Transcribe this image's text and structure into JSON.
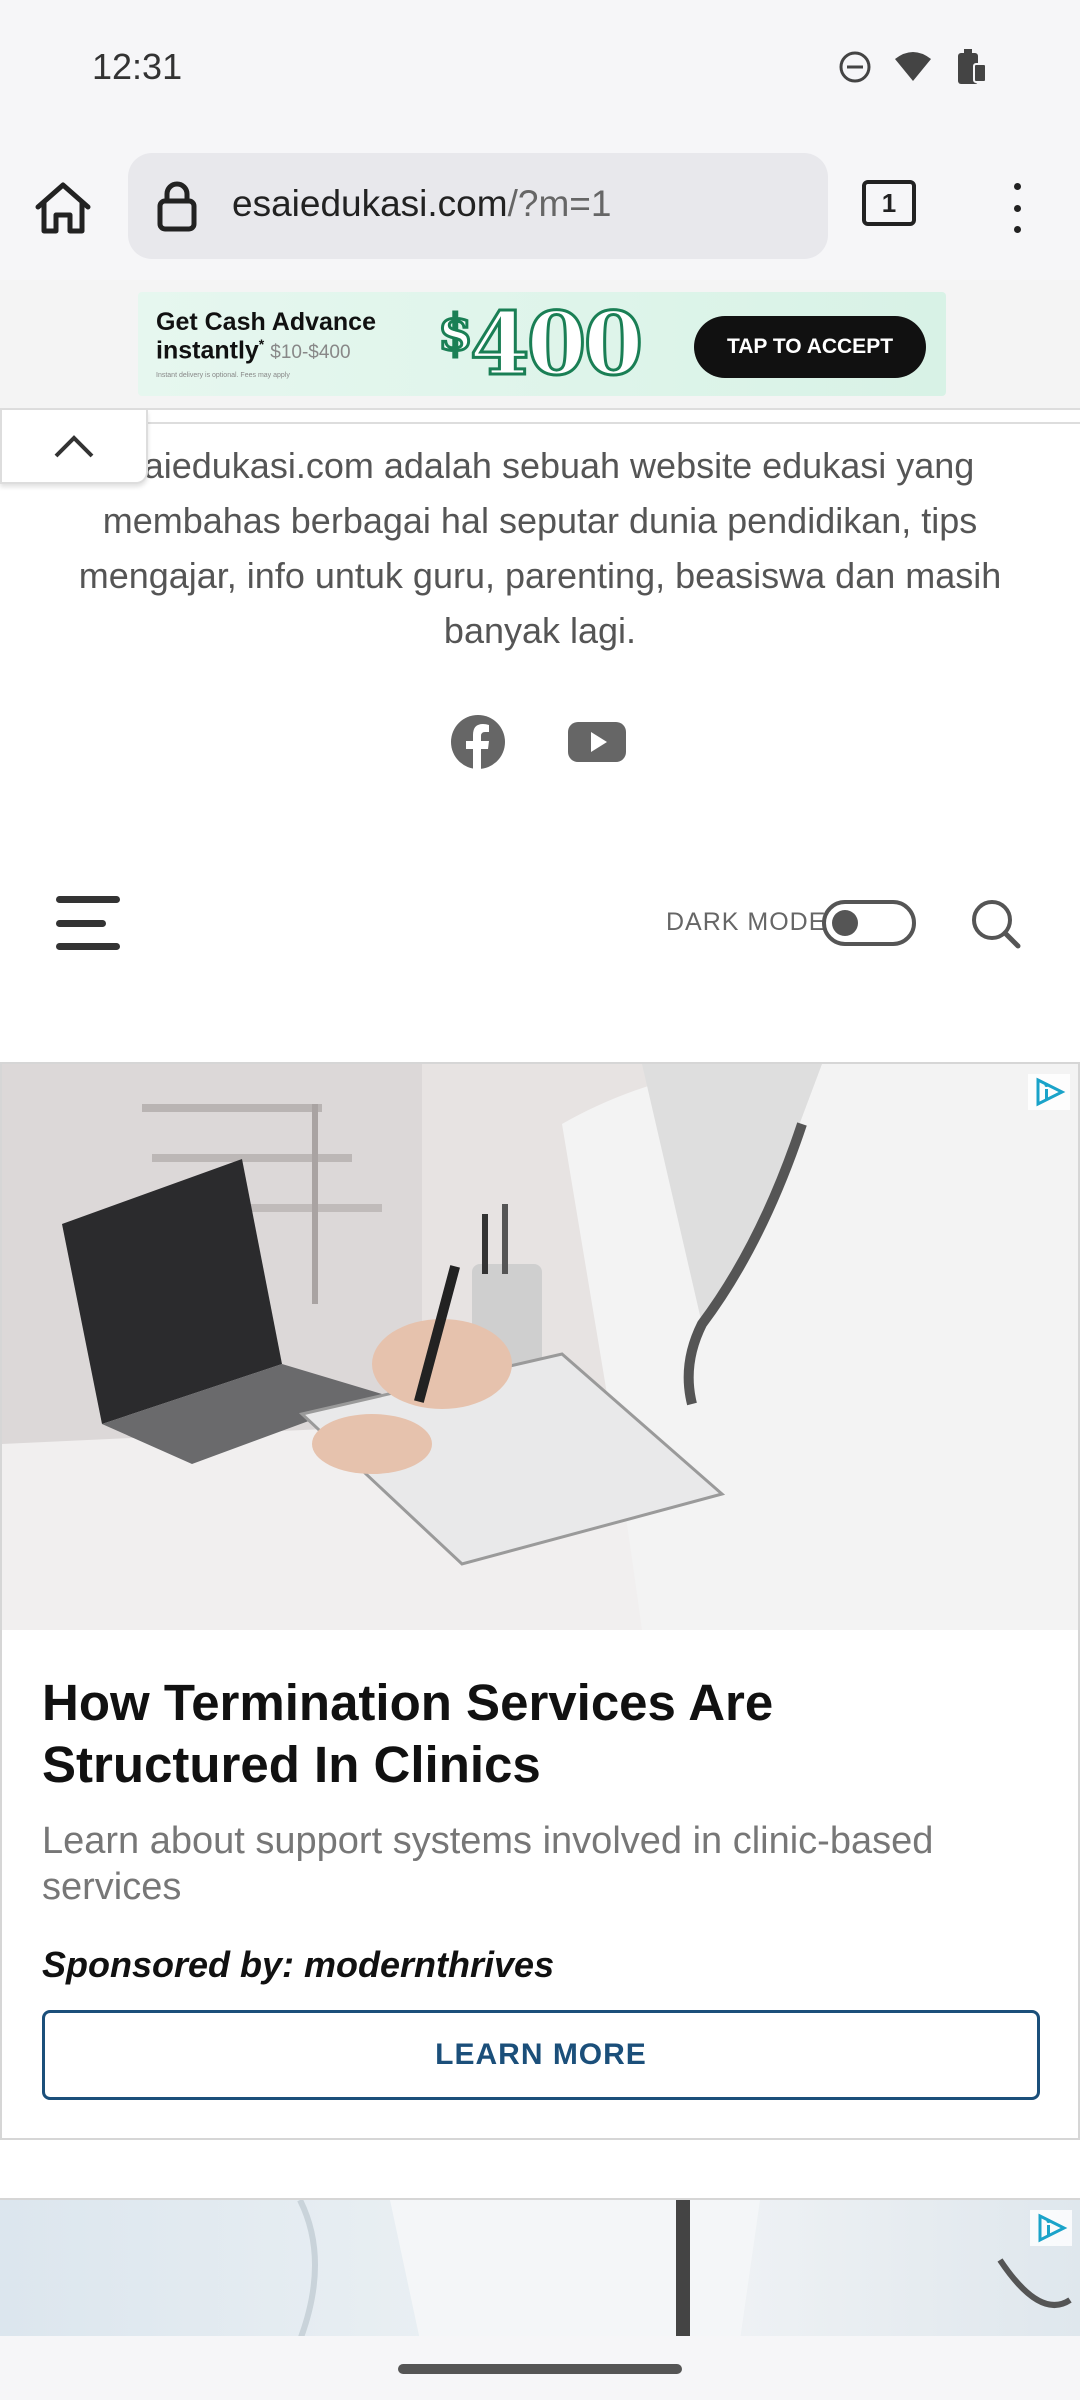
{
  "status_bar": {
    "time": "12:31",
    "icons": [
      "do-not-disturb-icon",
      "wifi-icon",
      "battery-icon"
    ]
  },
  "browser": {
    "url_main": "esaiedukasi.com",
    "url_path": "/?m=1",
    "tab_count": "1",
    "icons": [
      "home-icon",
      "lock-icon",
      "menu-dots-icon"
    ]
  },
  "top_ad": {
    "line1": "Get Cash Advance",
    "line2": "instantly",
    "marker": "*",
    "range": "$10-$400",
    "fine_print": "Instant delivery is optional. Fees may apply",
    "amount": "400",
    "currency": "$",
    "cta": "TAP TO ACCEPT",
    "brand_color": "#1a7f55"
  },
  "site": {
    "description": "esaiedukasi.com adalah sebuah website edukasi yang membahas berbagai hal seputar dunia pendidikan, tips mengajar, info untuk guru, parenting, beasiswa dan masih banyak lagi.",
    "social_icons": [
      "facebook-icon",
      "youtube-icon"
    ]
  },
  "nav": {
    "dark_mode_label": "DARK MODE",
    "dark_mode_on": false
  },
  "ad_card": {
    "title": "How Termination Services Are Structured In Clinics",
    "body": "Learn about support systems involved in clinic-based services",
    "sponsor": "Sponsored by: modernthrives",
    "button": "LEARN MORE",
    "accent": "#1b4f7a"
  }
}
